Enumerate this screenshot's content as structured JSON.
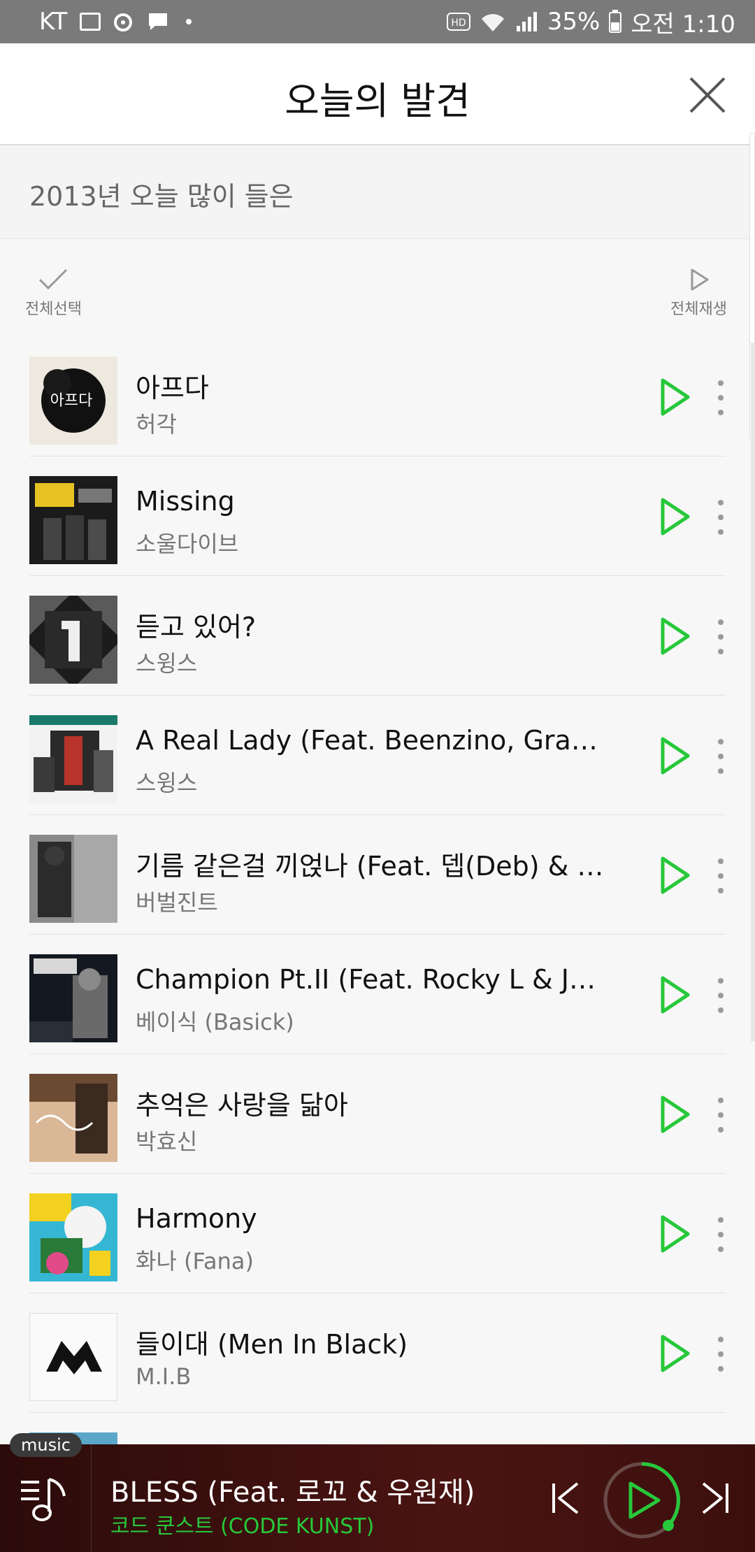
{
  "status_bar": {
    "carrier": "KT",
    "battery": "35%",
    "time": "오전 1:10",
    "icons": [
      "image-icon",
      "record-icon",
      "chat-icon",
      "dot-icon",
      "hd-icon",
      "wifi-icon",
      "signal-icon",
      "battery-icon"
    ]
  },
  "header": {
    "title": "오늘의 발견",
    "close_icon": "close-icon"
  },
  "subtitle": "2013년 오늘 많이 들은",
  "toolbar": {
    "select_all": "전체선택",
    "play_all": "전체재생"
  },
  "tracks": [
    {
      "title": "아프다",
      "artist": "허각"
    },
    {
      "title": "Missing",
      "artist": "소울다이브"
    },
    {
      "title": "듣고 있어?",
      "artist": "스윙스"
    },
    {
      "title": "A Real Lady (Feat. Beenzino, Gray &...",
      "artist": "스윙스"
    },
    {
      "title": "기름 같은걸 끼얹나 (Feat. 뎁(Deb) & Be...",
      "artist": "버벌진트"
    },
    {
      "title": "Champion Pt.II (Feat. Rocky L & JTO...",
      "artist": "베이식 (Basick)"
    },
    {
      "title": "추억은 사랑을 닮아",
      "artist": "박효신"
    },
    {
      "title": "Harmony",
      "artist": "화나 (Fana)"
    },
    {
      "title": "들이대 (Men In Black)",
      "artist": "M.I.B"
    }
  ],
  "player": {
    "tag": "music",
    "title": "BLESS (Feat. 로꼬 & 우원재)",
    "artist": "코드 쿤스트 (CODE KUNST)"
  },
  "colors": {
    "accent_green": "#27c83a",
    "status_bar": "#7a7a7a",
    "player_bg": "#3a100f"
  }
}
